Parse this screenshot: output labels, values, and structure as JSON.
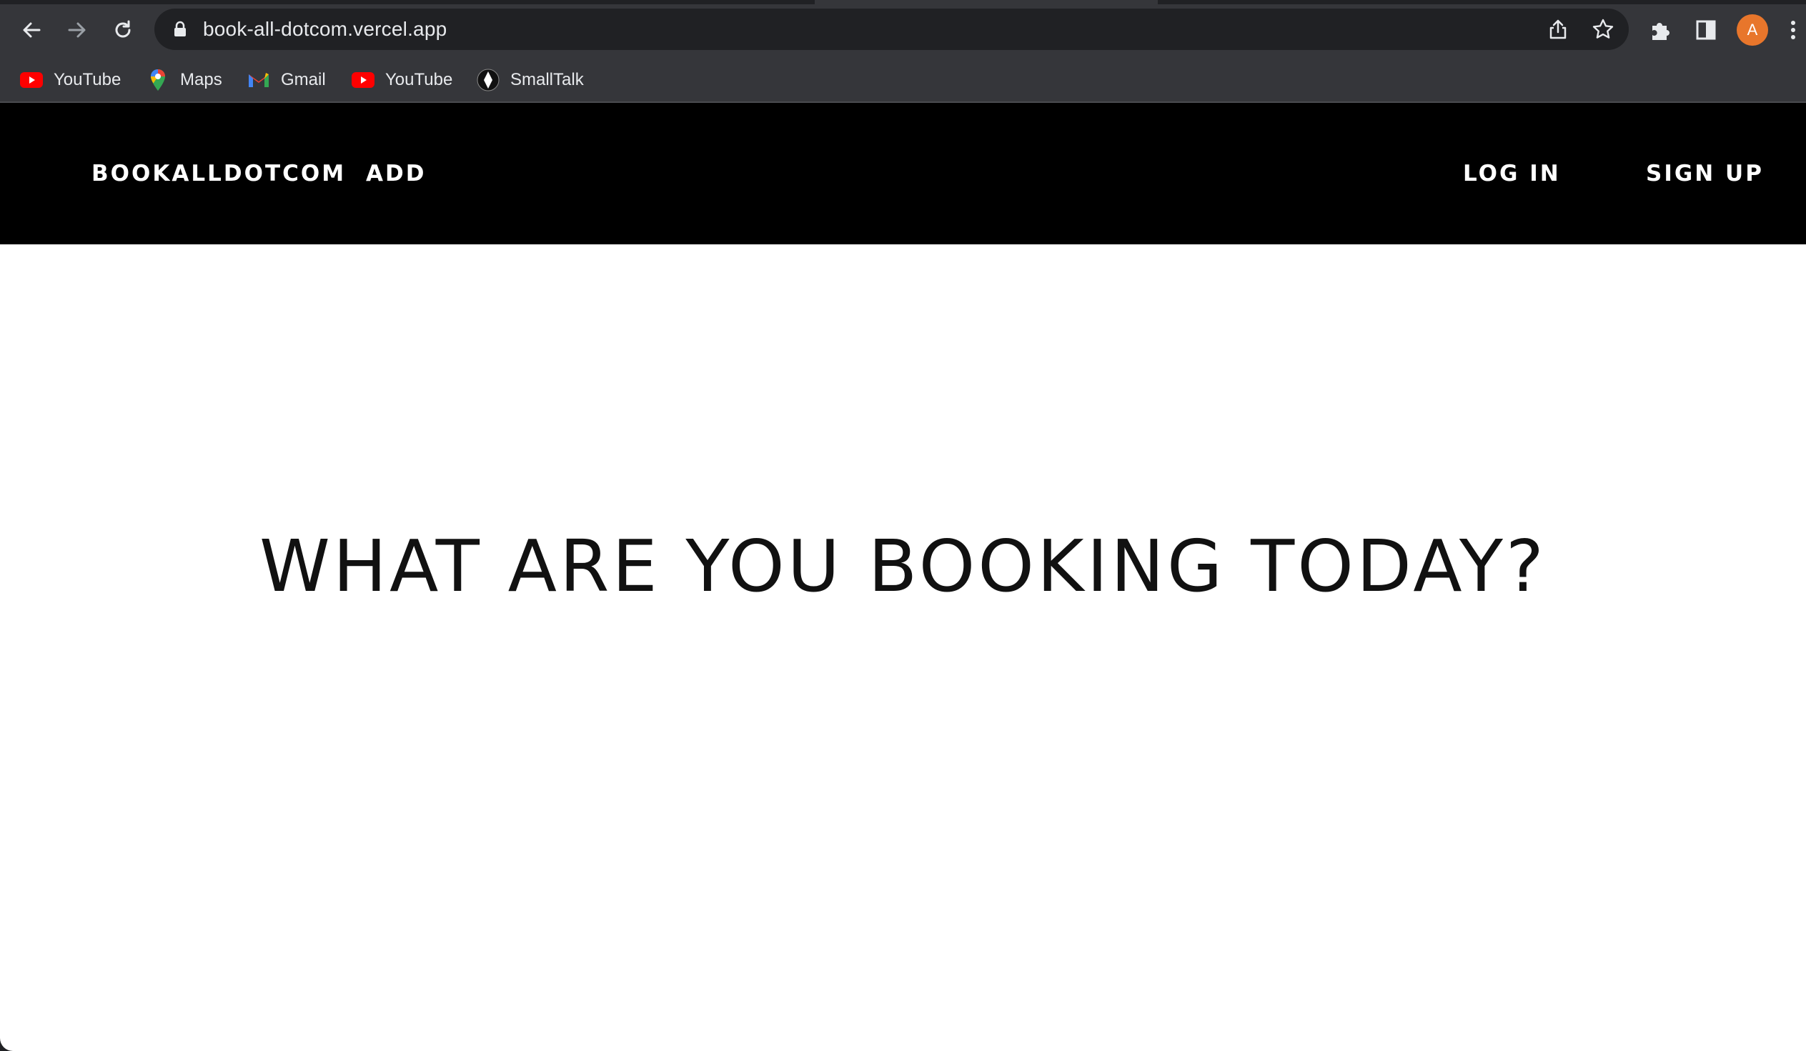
{
  "browser": {
    "url": "book-all-dotcom.vercel.app",
    "profile_initial": "A",
    "accent_color": "#e8762b",
    "icons": {
      "back": "arrow-left-icon",
      "forward": "arrow-right-icon",
      "reload": "reload-icon",
      "lock": "lock-icon",
      "share": "share-icon",
      "bookmark": "star-icon",
      "extensions": "puzzle-icon",
      "side_panel": "side-panel-icon",
      "menu": "kebab-menu-icon"
    }
  },
  "bookmarks": [
    {
      "label": "YouTube",
      "icon": "youtube-icon"
    },
    {
      "label": "Maps",
      "icon": "maps-pin-icon"
    },
    {
      "label": "Gmail",
      "icon": "gmail-icon"
    },
    {
      "label": "YouTube",
      "icon": "youtube-icon"
    },
    {
      "label": "SmallTalk",
      "icon": "smalltalk-icon"
    }
  ],
  "site": {
    "nav": {
      "brand": "BOOKALLDOTCOM",
      "add": "ADD",
      "login": "LOG IN",
      "signup": "SIGN UP"
    },
    "hero_title": "WHAT ARE YOU BOOKING TODAY?",
    "nav_background": "#000000",
    "page_background": "#ffffff"
  }
}
